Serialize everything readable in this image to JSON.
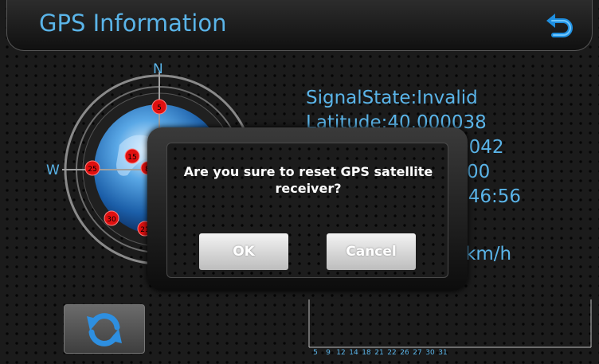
{
  "header": {
    "title": "GPS Information",
    "back_icon": "back-arrow-icon"
  },
  "compass": {
    "north_label": "N",
    "west_label": "W",
    "satellites": [
      "5",
      "15",
      "25",
      "30",
      "21",
      "8"
    ]
  },
  "info": {
    "signal_state": "SignalState:Invalid",
    "latitude": "Latitude:40.000038",
    "line3_visible": "0042",
    "line4_visible": "00",
    "line5_visible": ":46:56",
    "speed_visible": "km/h"
  },
  "signal_chart": {
    "channels": [
      "5",
      "9",
      "12",
      "14",
      "18",
      "21",
      "22",
      "26",
      "27",
      "30",
      "31"
    ]
  },
  "refresh_button": {
    "icon": "refresh-icon"
  },
  "dialog": {
    "message_line1": "Are you sure to reset GPS satellite",
    "message_line2": "receiver?",
    "ok_label": "OK",
    "cancel_label": "Cancel"
  },
  "colors": {
    "accent": "#5ab4e8",
    "satellite_red": "#e01010"
  }
}
